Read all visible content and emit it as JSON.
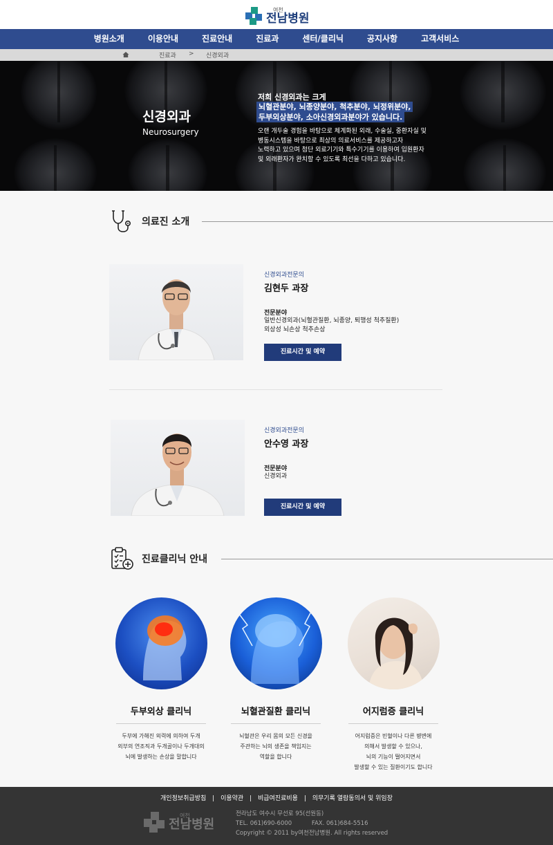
{
  "header": {
    "logo_small": "여천",
    "logo_big": "전남병원"
  },
  "nav": {
    "items": [
      "병원소개",
      "이용안내",
      "진료안내",
      "진료과",
      "센터/클리닉",
      "공지사항",
      "고객서비스"
    ]
  },
  "breadcrumb": {
    "level1": "진료과",
    "separator": ">",
    "level2": "신경외과"
  },
  "hero": {
    "title": "신경외과",
    "subtitle": "Neurosurgery",
    "lead": "저희 신경외과는 크게",
    "highlight1": "뇌혈관분야, 뇌종양분야, 척추분야, 뇌정위분야,",
    "highlight2": "두부외상분야, 소아신경외과분야가 있습니다.",
    "desc1": "오랜 개두술 경험을 바탕으로 체계화된 외래, 수술실, 중환자실 및",
    "desc2": "병동시스템을 바탕으로 최상의 의료서비스를 제공하고자",
    "desc3": "노력하고 있으며 첨단 외료기기와 특수기기를 이용하여 입원환자",
    "desc4": "및 외래환자가 완치할 수 있도록 최선을 다하고 있습니다."
  },
  "staff_section": {
    "title": "의료진 소개",
    "icon": "stethoscope-icon"
  },
  "doctors": [
    {
      "specialty": "신경외과전문의",
      "name": "김현두 과장",
      "field_label": "전문분야",
      "field_line1": "일반신경외과(뇌혈관질환, 뇌종양, 퇴행성 척추질환)",
      "field_line2": "외상성 뇌손상 척추손상",
      "button": "진료시간 및 예약"
    },
    {
      "specialty": "신경외과전문의",
      "name": "안수영 과장",
      "field_label": "전문분야",
      "field_line1": "신경외과",
      "field_line2": "",
      "button": "진료시간 및 예약"
    }
  ],
  "clinic_section": {
    "title": "진료클리닉 안내",
    "icon": "clipboard-icon"
  },
  "clinics": [
    {
      "title": "두부외상 클리닉",
      "desc1": "두부에 가해진 외력에 의하여 두개",
      "desc2": "외부의 연조직과 두개골이나 두개대의",
      "desc3": "뇌에 발생하는 손상을 말합니다",
      "desc4": ""
    },
    {
      "title": "뇌혈관질환 클리닉",
      "desc1": "뇌혈관은 우리 몸의 모든 신경을",
      "desc2": "주관하는 뇌의 생존을 책임지는",
      "desc3": "역할을 합니다",
      "desc4": ""
    },
    {
      "title": "어지럼증 클리닉",
      "desc1": "어지럼증은 빈혈이나 다른 병변에",
      "desc2": "의해서 발생할 수 있으나,",
      "desc3": "뇌의 기능이 떨어지면서",
      "desc4": "발생할 수 있는 질환이기도 합니다"
    }
  ],
  "footer": {
    "links": [
      "개인정보취급방침",
      "이용약관",
      "비급여진료비용",
      "의무기록 열람동의서 및 위임장"
    ],
    "separator": "|",
    "logo_small": "여천",
    "logo_big": "전남병원",
    "address": "전라남도 여수시 무선로 95(선원동)",
    "tel": "TEL. 061)690-6000",
    "fax": "FAX. 061)684-5516",
    "copyright": "Copyright © 2011 by여천전남병원. All rights reserved"
  },
  "colors": {
    "nav_bg": "#2f4c8f",
    "button_bg": "#213b7a",
    "footer_bg": "#343434",
    "highlight_bg": "#2f4c8f"
  }
}
